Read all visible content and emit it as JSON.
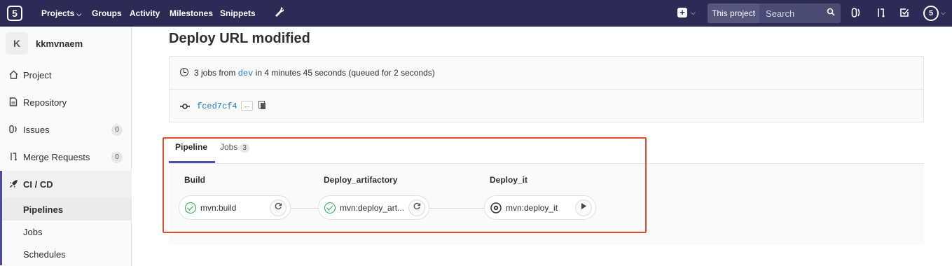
{
  "navbar": {
    "logo": "5",
    "links": [
      {
        "label": "Projects",
        "caret": "⌵"
      },
      {
        "label": "Groups"
      },
      {
        "label": "Activity"
      },
      {
        "label": "Milestones"
      },
      {
        "label": "Snippets"
      }
    ],
    "search_scope": "This project",
    "search_placeholder": "Search",
    "user_avatar": "5",
    "icons": [
      "wrench-icon",
      "plus-square-icon",
      "search-icon",
      "issues-icon",
      "merge-request-icon",
      "todo-icon",
      "user-avatar"
    ]
  },
  "sidebar": {
    "project_initial": "K",
    "project_name": "kkmvnaem",
    "items": [
      {
        "label": "Project",
        "icon": "home-icon"
      },
      {
        "label": "Repository",
        "icon": "document-icon"
      },
      {
        "label": "Issues",
        "icon": "issues-icon",
        "count": "0"
      },
      {
        "label": "Merge Requests",
        "icon": "merge-request-icon",
        "count": "0"
      },
      {
        "label": "CI / CD",
        "icon": "rocket-icon"
      }
    ],
    "subitems": [
      {
        "label": "Pipelines"
      },
      {
        "label": "Jobs"
      },
      {
        "label": "Schedules"
      }
    ]
  },
  "page": {
    "title": "Deploy URL modified",
    "info_prefix": "3 jobs from ",
    "ref": "dev",
    "info_suffix": " in 4 minutes 45 seconds (queued for 2 seconds)",
    "commit_sha": "fced7cf4",
    "ellipsis": "..."
  },
  "tabs": [
    {
      "label": "Pipeline"
    },
    {
      "label": "Jobs",
      "count": "3"
    }
  ],
  "pipeline": {
    "stages": [
      {
        "title": "Build",
        "job": "mvn:build",
        "status": "success",
        "action": "retry"
      },
      {
        "title": "Deploy_artifactory",
        "job": "mvn:deploy_art...",
        "status": "success",
        "action": "retry"
      },
      {
        "title": "Deploy_it",
        "job": "mvn:deploy_it",
        "status": "manual",
        "action": "play"
      }
    ]
  },
  "colors": {
    "navbar": "#2d2b55",
    "accent": "#4b4ba3",
    "success": "#1aaa55",
    "link": "#1f78d1",
    "highlight": "#e24b33"
  }
}
